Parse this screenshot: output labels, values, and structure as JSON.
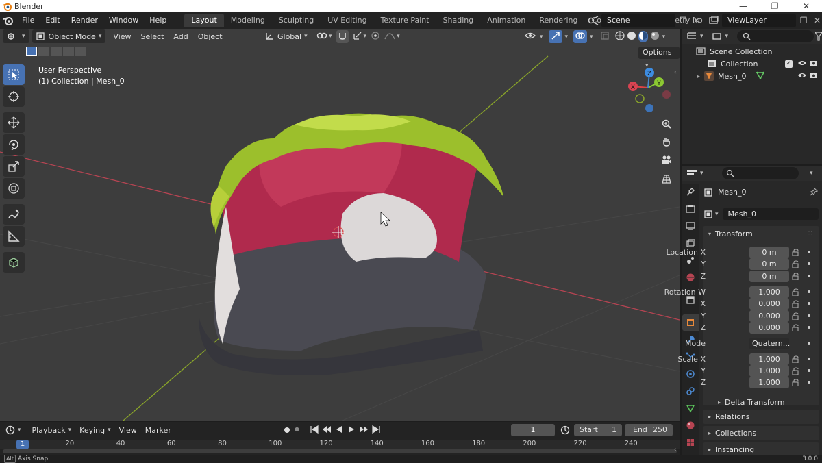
{
  "window": {
    "title": "Blender",
    "buttons": [
      "—",
      "❐",
      "✕"
    ]
  },
  "menus": [
    "File",
    "Edit",
    "Render",
    "Window",
    "Help"
  ],
  "workspaces": [
    "Layout",
    "Modeling",
    "Sculpting",
    "UV Editing",
    "Texture Paint",
    "Shading",
    "Animation",
    "Rendering",
    "Compositing",
    "Geometry No"
  ],
  "active_workspace": "Layout",
  "scene": "Scene",
  "view_layer": "ViewLayer",
  "viewport": {
    "mode": "Object Mode",
    "menus": [
      "View",
      "Select",
      "Add",
      "Object"
    ],
    "orientation": "Global",
    "overlay_title": "User Perspective",
    "overlay_sub": "(1) Collection | Mesh_0",
    "options": "Options",
    "gizmo": {
      "x": "X",
      "y": "Y",
      "z": "Z"
    }
  },
  "outliner": {
    "rows": [
      {
        "label": "Scene Collection"
      },
      {
        "label": "Collection"
      },
      {
        "label": "Mesh_0"
      }
    ]
  },
  "properties": {
    "object_name": "Mesh_0",
    "data_name": "Mesh_0",
    "transform_title": "Transform",
    "location": {
      "label": "Location X",
      "x": "0 m",
      "y": "0 m",
      "z": "0 m"
    },
    "rotation": {
      "label": "Rotation W",
      "w": "1.000",
      "x": "0.000",
      "y": "0.000",
      "z": "0.000"
    },
    "mode_label": "Mode",
    "mode_value": "Quatern...",
    "scale": {
      "label": "Scale X",
      "x": "1.000",
      "y": "1.000",
      "z": "1.000"
    },
    "axis_labels": {
      "x": "X",
      "y": "Y",
      "z": "Z"
    },
    "sections": [
      "Delta Transform",
      "Relations",
      "Collections",
      "Instancing"
    ]
  },
  "timeline": {
    "menus": [
      "Playback",
      "Keying",
      "View",
      "Marker"
    ],
    "current_frame": "1",
    "start_label": "Start",
    "start": "1",
    "end_label": "End",
    "end": "250",
    "ruler": [
      "1",
      "20",
      "40",
      "60",
      "80",
      "100",
      "120",
      "140",
      "160",
      "180",
      "200",
      "220",
      "240"
    ]
  },
  "status": {
    "left": "Axis Snap",
    "version": "3.0.0"
  },
  "colors": {
    "accent": "#4772b3",
    "viewport_bg": "#3d3d3d",
    "x_axis": "#b64452",
    "y_axis": "#8aa52a"
  }
}
